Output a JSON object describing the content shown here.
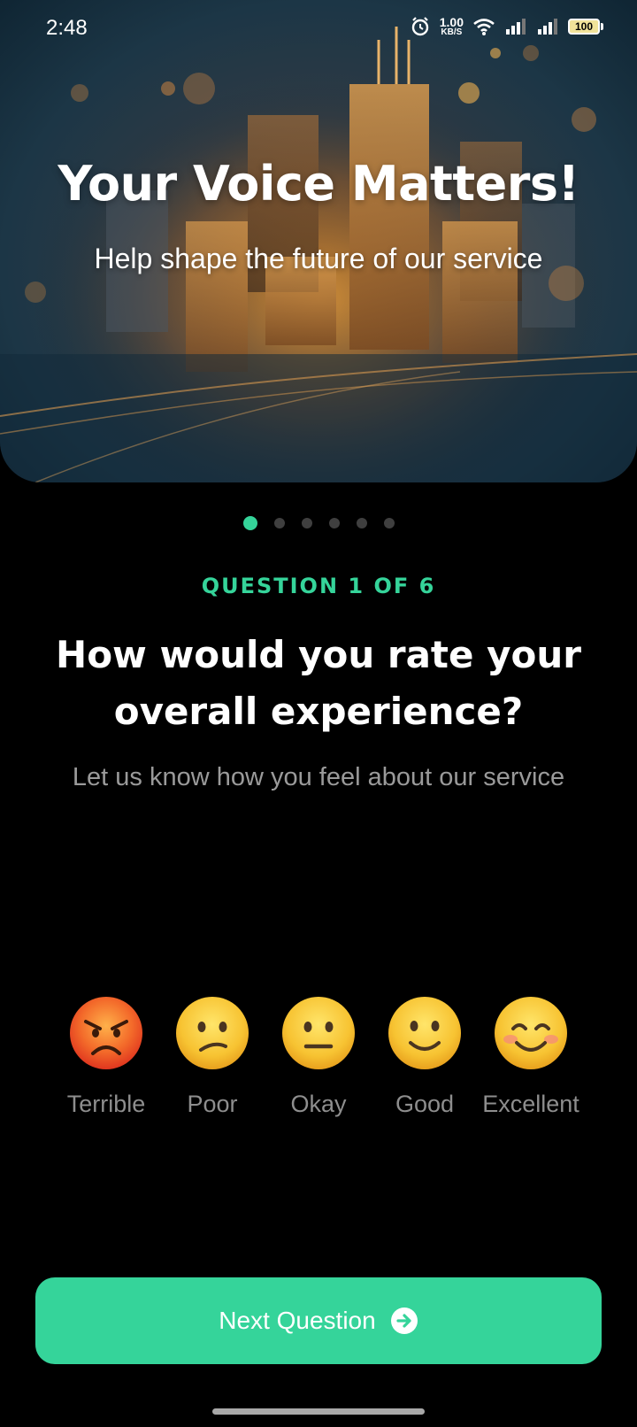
{
  "status_bar": {
    "time": "2:48",
    "net_speed_value": "1.00",
    "net_speed_unit": "KB/S",
    "battery_level": "100",
    "icons": [
      "alarm-icon",
      "wifi-icon",
      "signal-icon",
      "signal-icon"
    ]
  },
  "hero": {
    "title": "Your Voice Matters!",
    "subtitle": "Help shape the future of our service"
  },
  "progress": {
    "current": 1,
    "total": 6,
    "active_color": "#35d49a",
    "inactive_color": "#3f3f3f"
  },
  "question": {
    "label": "QUESTION 1 OF 6",
    "title": "How would you rate your overall experience?",
    "subtitle": "Let us know how you feel about our service"
  },
  "ratings": [
    {
      "label": "Terrible",
      "icon": "angry-face-icon"
    },
    {
      "label": "Poor",
      "icon": "confused-face-icon"
    },
    {
      "label": "Okay",
      "icon": "neutral-face-icon"
    },
    {
      "label": "Good",
      "icon": "slightly-smiling-face-icon"
    },
    {
      "label": "Excellent",
      "icon": "smiling-face-with-smiling-eyes-icon"
    }
  ],
  "next_button": {
    "label": "Next Question",
    "icon": "arrow-right-circle-icon",
    "color": "#35d49a"
  },
  "colors": {
    "accent": "#35d49a",
    "background": "#000000",
    "muted_text": "#9a9a9a"
  }
}
